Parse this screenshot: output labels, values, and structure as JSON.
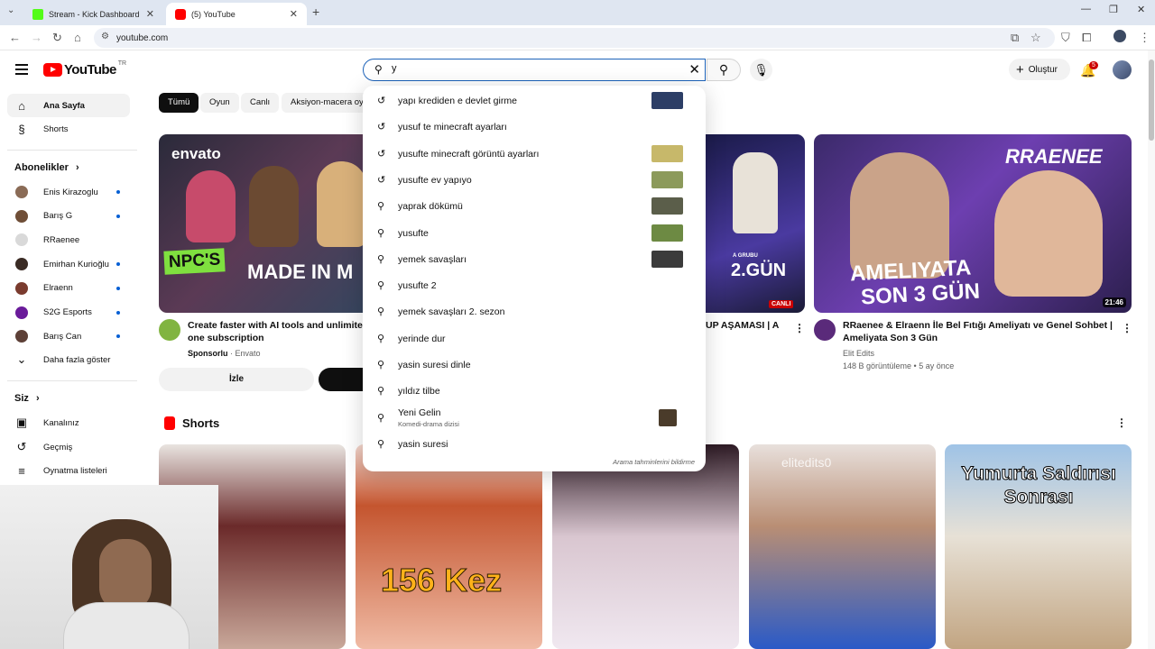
{
  "browser": {
    "tabs": [
      {
        "title": "Stream - Kick Dashboard",
        "favicon_color": "#53fc18"
      },
      {
        "title": "(5) YouTube",
        "favicon_color": "#ff0000"
      }
    ],
    "url": "youtube.com"
  },
  "header": {
    "logo_text": "YouTube",
    "country_code": "TR",
    "search_value": "y",
    "create_label": "Oluştur",
    "notification_count": "5"
  },
  "sidebar": {
    "main": [
      {
        "label": "Ana Sayfa",
        "icon": "home-icon"
      },
      {
        "label": "Shorts",
        "icon": "shorts-icon"
      }
    ],
    "subscriptions_heading": "Abonelikler",
    "subscriptions": [
      {
        "label": "Enis Kirazoglu",
        "color": "#8a6b56",
        "dot": true
      },
      {
        "label": "Barış G",
        "color": "#6f4e37",
        "dot": true
      },
      {
        "label": "RRaenee",
        "color": "#d9d9d9",
        "dot": false
      },
      {
        "label": "Emirhan Kurioğlu",
        "color": "#3a2b24",
        "dot": true
      },
      {
        "label": "Elraenn",
        "color": "#7a3b2e",
        "dot": true
      },
      {
        "label": "S2G Esports",
        "color": "#6a1b9a",
        "dot": true
      },
      {
        "label": "Barış Can",
        "color": "#5d4037",
        "dot": true
      }
    ],
    "show_more": "Daha fazla göster",
    "you_heading": "Siz",
    "you": [
      {
        "label": "Kanalınız",
        "icon": "channel-icon"
      },
      {
        "label": "Geçmiş",
        "icon": "history-icon"
      },
      {
        "label": "Oynatma listeleri",
        "icon": "playlist-icon"
      }
    ]
  },
  "chips": [
    "Tümü",
    "Oyun",
    "Canlı",
    "Aksiyon-macera oy"
  ],
  "videos": [
    {
      "title_line1": "Create faster with AI tools and unlimited",
      "title_line2": "one subscription",
      "sponsored": "Sponsorlu",
      "channel": "Envato",
      "thumb_brand": "envato",
      "thumb_text": "NPC'S",
      "thumb_text2": "MADE IN M",
      "cta": "İzle"
    },
    {
      "title_partial": "UP AŞAMASI | A",
      "thumb_text": "2.GÜN",
      "thumb_sub": "A GRUBU",
      "live": "CANLI"
    },
    {
      "title_line1": "RRaenee & Elraenn İle Bel Fıtığı Ameliyatı ve Genel Sohbet |",
      "title_line2": "Ameliyata Son 3 Gün",
      "channel": "Elit Edits",
      "meta": "148 B görüntüleme • 5 ay önce",
      "duration": "21:46",
      "thumb_text": "RRAENEE",
      "thumb_text2": "AMELIYATA",
      "thumb_text3": "SON 3 GÜN"
    }
  ],
  "shorts": {
    "heading": "Shorts",
    "items": [
      {
        "text": ""
      },
      {
        "text": "156 Kez"
      },
      {
        "text": ""
      },
      {
        "text": "elitedits0"
      },
      {
        "text": "Yumurta Saldırısı Sonrası"
      }
    ]
  },
  "suggestions": [
    {
      "text": "yapı krediden e devlet girme",
      "type": "history",
      "thumb": "#2c3e66"
    },
    {
      "text": "yusuf te minecraft ayarları",
      "type": "history",
      "thumb": ""
    },
    {
      "text": "yusufte minecraft görüntü ayarları",
      "type": "history",
      "thumb": "#c7b86a"
    },
    {
      "text": "yusufte ev yapıyo",
      "type": "history",
      "thumb": "#8c9a5b"
    },
    {
      "text": "yaprak dökümü",
      "type": "search",
      "thumb": "#5b5e4a"
    },
    {
      "text": "yusufte",
      "type": "search",
      "thumb": "#6d8a43"
    },
    {
      "text": "yemek savaşları",
      "type": "search",
      "thumb": "#3b3b3b"
    },
    {
      "text": "yusufte 2",
      "type": "search",
      "thumb": ""
    },
    {
      "text": "yemek savaşları 2. sezon",
      "type": "search",
      "thumb": ""
    },
    {
      "text": "yerinde dur",
      "type": "search",
      "thumb": ""
    },
    {
      "text": "yasin suresi dinle",
      "type": "search",
      "thumb": ""
    },
    {
      "text": "yıldız tilbe",
      "type": "search",
      "thumb": ""
    },
    {
      "text": "Yeni Gelin",
      "sub": "Komedi-drama dizisi",
      "type": "search",
      "thumb": "#4a3b2a"
    },
    {
      "text": "yasin suresi",
      "type": "search",
      "thumb": ""
    }
  ],
  "dropdown_footer": "Arama tahminlerini bildirme"
}
